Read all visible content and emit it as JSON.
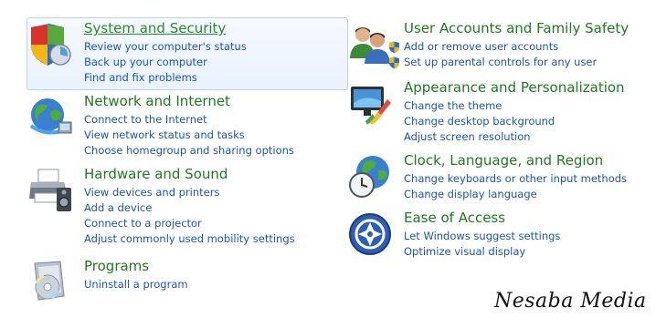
{
  "categories": {
    "system_security": {
      "title": "System and Security",
      "icon": "security-shield-icon",
      "links": [
        "Review your computer's status",
        "Back up your computer",
        "Find and fix problems"
      ]
    },
    "network_internet": {
      "title": "Network and Internet",
      "icon": "network-globe-icon",
      "links": [
        "Connect to the Internet",
        "View network status and tasks",
        "Choose homegroup and sharing options"
      ]
    },
    "hardware_sound": {
      "title": "Hardware and Sound",
      "icon": "printer-speaker-icon",
      "links": [
        "View devices and printers",
        "Add a device",
        "Connect to a projector",
        "Adjust commonly used mobility settings"
      ]
    },
    "programs": {
      "title": "Programs",
      "icon": "programs-disc-icon",
      "links": [
        "Uninstall a program"
      ]
    },
    "user_accounts": {
      "title": "User Accounts and Family Safety",
      "icon": "users-icon",
      "links": [
        "Add or remove user accounts",
        "Set up parental controls for any user"
      ]
    },
    "appearance": {
      "title": "Appearance and Personalization",
      "icon": "monitor-paint-icon",
      "links": [
        "Change the theme",
        "Change desktop background",
        "Adjust screen resolution"
      ]
    },
    "clock_language": {
      "title": "Clock, Language, and Region",
      "icon": "globe-clock-icon",
      "links": [
        "Change keyboards or other input methods",
        "Change display language"
      ]
    },
    "ease_access": {
      "title": "Ease of Access",
      "icon": "ease-of-access-icon",
      "links": [
        "Let Windows suggest settings",
        "Optimize visual display"
      ]
    }
  },
  "watermark": "Nesaba Media",
  "colors": {
    "title": "#1e7a1e",
    "link": "#1c54b0",
    "highlight_border": "#b9d3ee"
  }
}
